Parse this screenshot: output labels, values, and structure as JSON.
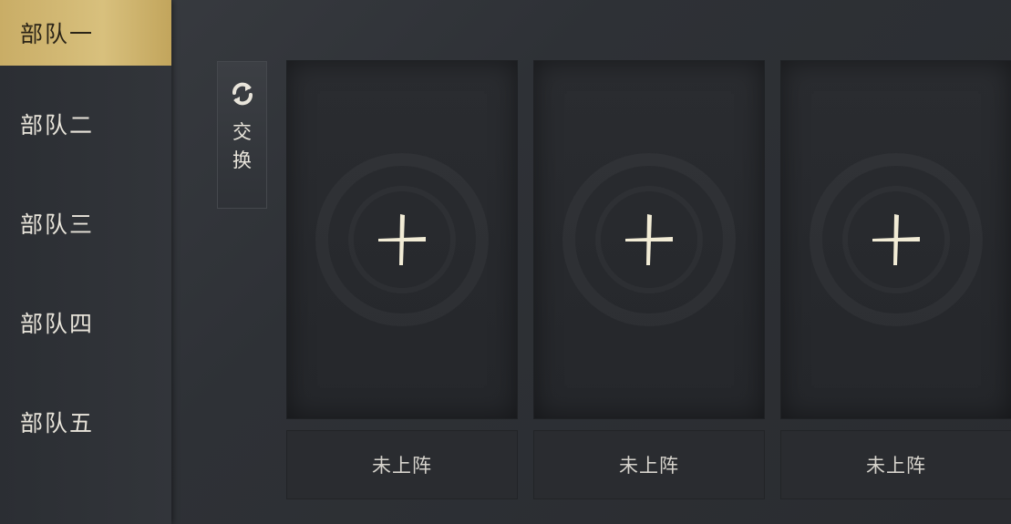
{
  "sidebar": {
    "tabs": [
      {
        "label": "部队一",
        "active": true
      },
      {
        "label": "部队二",
        "active": false
      },
      {
        "label": "部队三",
        "active": false
      },
      {
        "label": "部队四",
        "active": false
      },
      {
        "label": "部队五",
        "active": false
      }
    ]
  },
  "swap_button": {
    "label": "交换",
    "icon": "swap-icon"
  },
  "slots": [
    {
      "icon": "plus-icon",
      "status": "未上阵"
    },
    {
      "icon": "plus-icon",
      "status": "未上阵"
    },
    {
      "icon": "plus-icon",
      "status": "未上阵"
    }
  ],
  "colors": {
    "accent": "#d4b86f",
    "plus": "#f2ecd6",
    "background": "#2e3136"
  }
}
